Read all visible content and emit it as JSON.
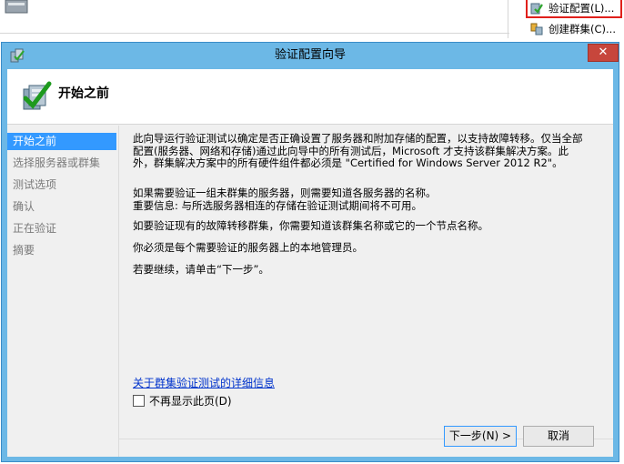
{
  "background": {
    "actions": {
      "validate_label": "验证配置(L)...",
      "create_label": "创建群集(C)..."
    }
  },
  "wizard": {
    "title": "验证配置向导",
    "close_glyph": "✕",
    "header_title": "开始之前",
    "nav": [
      {
        "label": "开始之前",
        "active": true
      },
      {
        "label": "选择服务器或群集"
      },
      {
        "label": "测试选项"
      },
      {
        "label": "确认"
      },
      {
        "label": "正在验证"
      },
      {
        "label": "摘要"
      }
    ],
    "content": {
      "p1": "此向导运行验证测试以确定是否正确设置了服务器和附加存储的配置，以支持故障转移。仅当全部配置(服务器、网络和存储)通过此向导中的所有测试后，Microsoft 才支持该群集解决方案。此外，群集解决方案中的所有硬件组件都必须是 \"Certified for Windows Server 2012 R2\"。",
      "p2": "如果需要验证一组未群集的服务器，则需要知道各服务器的名称。",
      "p3": "重要信息: 与所选服务器相连的存储在验证测试期间将不可用。",
      "p4": "如要验证现有的故障转移群集，你需要知道该群集名称或它的一个节点名称。",
      "p5": "你必须是每个需要验证的服务器上的本地管理员。",
      "p6": "若要继续，请单击“下一步”。",
      "link": "关于群集验证测试的详细信息",
      "checkbox_label": "不再显示此页(D)"
    },
    "buttons": {
      "next": "下一步(N) >",
      "cancel": "取消"
    }
  }
}
